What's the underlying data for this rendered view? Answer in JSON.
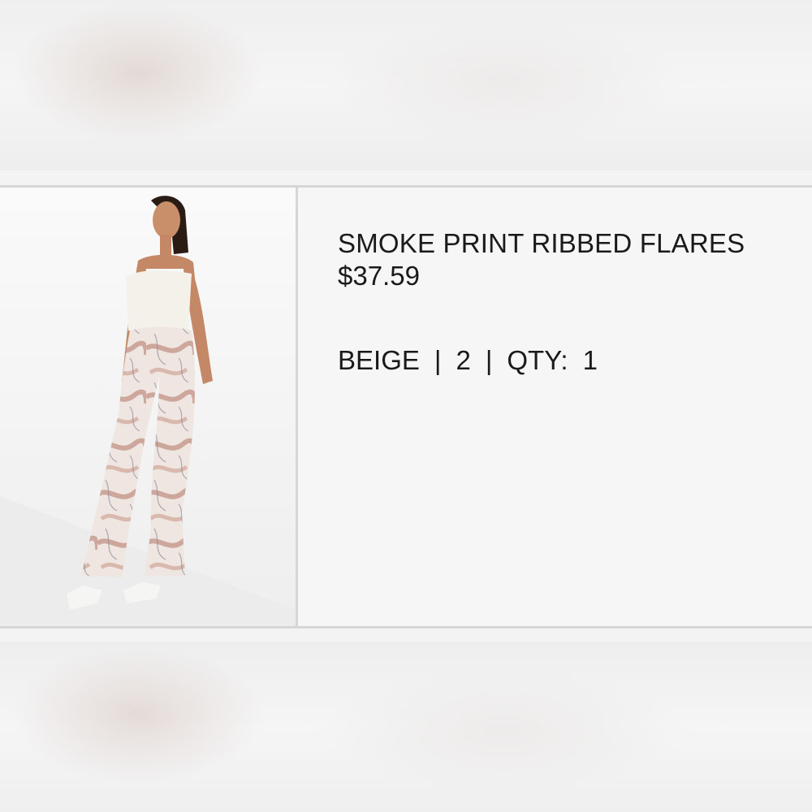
{
  "product": {
    "title": "SMOKE PRINT RIBBED FLARES",
    "price": "$37.59",
    "color": "BEIGE",
    "separator": "|",
    "size": "2",
    "qty_label": "QTY:",
    "qty_value": "1",
    "image_icon": "product-photo"
  },
  "colors": {
    "background": "#f3f3f3",
    "card": "#f6f6f6",
    "border": "#d6d6d6",
    "text": "#1a1a1a",
    "print_accent": "#a9614f"
  }
}
